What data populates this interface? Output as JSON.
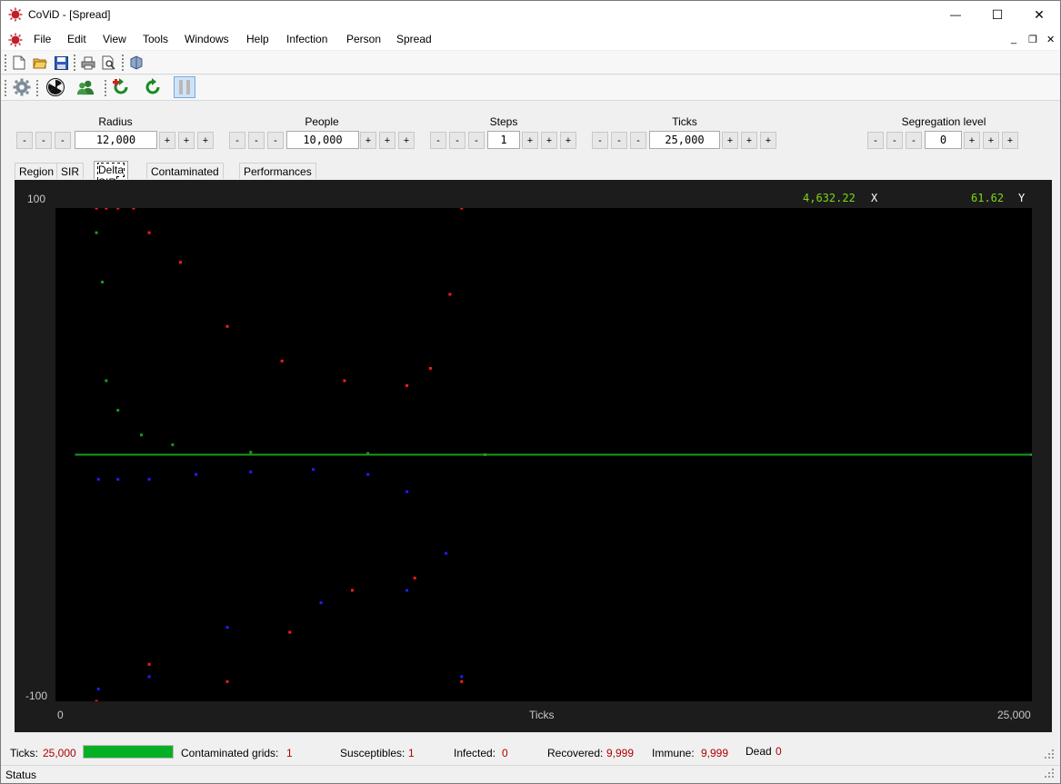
{
  "window": {
    "title": "CoViD - [Spread]"
  },
  "window_controls": {
    "minimize": "—",
    "maximize": "☐",
    "close": "✕"
  },
  "menu": {
    "items": [
      {
        "label": "File"
      },
      {
        "label": "Edit"
      },
      {
        "label": "View"
      },
      {
        "label": "Tools"
      },
      {
        "label": "Windows"
      },
      {
        "label": "Help"
      },
      {
        "label": "Infection"
      },
      {
        "label": "Person"
      },
      {
        "label": "Spread"
      }
    ],
    "mdi": {
      "minimize": "_",
      "restore": "❐",
      "close": "✕"
    }
  },
  "toolbar1": {
    "icons": [
      "new-file-icon",
      "open-folder-icon",
      "save-icon",
      "print-icon",
      "print-preview-icon",
      "help-book-icon"
    ]
  },
  "toolbar2": {
    "icons": [
      "gear-icon",
      "radiation-icon",
      "people-icon",
      "restart-icon",
      "refresh-icon",
      "pause-icon"
    ]
  },
  "controls": {
    "minus": "-",
    "plus": "+",
    "radius": {
      "label": "Radius",
      "value": "12,000"
    },
    "people": {
      "label": "People",
      "value": "10,000"
    },
    "steps": {
      "label": "Steps",
      "value": "1"
    },
    "ticks": {
      "label": "Ticks",
      "value": "25,000"
    },
    "segregation": {
      "label": "Segregation level",
      "value": "0"
    }
  },
  "tabs": [
    {
      "label": "Region",
      "active": false
    },
    {
      "label": "SIR",
      "active": false
    },
    {
      "label": "Delta SIR",
      "active": true
    },
    {
      "label": "Contaminated grids",
      "active": false
    },
    {
      "label": "Performances",
      "active": false
    }
  ],
  "plot": {
    "ymax_label": "100",
    "ymin_label": "-100",
    "xmin_label": "0",
    "xmax_label": "25,000",
    "xlabel": "Ticks",
    "cursor": {
      "x_value": "4,632.22",
      "x_label": "X",
      "y_value": "61.62",
      "y_label": "Y"
    },
    "colors": {
      "background": "#000000",
      "red": "#ff1a1a",
      "green": "#1a9a1a",
      "blue": "#1f1fff",
      "readout": "#7cd817"
    }
  },
  "chart_data": {
    "type": "scatter",
    "x": {
      "min": 0,
      "max": 25000,
      "label": "Ticks"
    },
    "y": {
      "min": -100,
      "max": 100
    },
    "baseline": 0,
    "grid": false,
    "series": [
      {
        "color": "#ff1a1a",
        "points": [
          [
            1050,
            100
          ],
          [
            1300,
            100
          ],
          [
            1600,
            100
          ],
          [
            2000,
            100
          ],
          [
            2400,
            90
          ],
          [
            3200,
            78
          ],
          [
            4400,
            52
          ],
          [
            5800,
            38
          ],
          [
            7400,
            30
          ],
          [
            9000,
            28
          ],
          [
            9600,
            35
          ],
          [
            10100,
            65
          ],
          [
            10400,
            100
          ],
          [
            1050,
            -100
          ],
          [
            2400,
            -85
          ],
          [
            4400,
            -92
          ],
          [
            6000,
            -72
          ],
          [
            7600,
            -55
          ],
          [
            9200,
            -50
          ],
          [
            10400,
            -92
          ]
        ]
      },
      {
        "color": "#1a9a1a",
        "points": [
          [
            1050,
            90
          ],
          [
            1200,
            70
          ],
          [
            1300,
            30
          ],
          [
            1600,
            18
          ],
          [
            2200,
            8
          ],
          [
            3000,
            4
          ],
          [
            5000,
            1
          ],
          [
            8000,
            0.5
          ],
          [
            11000,
            0
          ],
          [
            25000,
            0
          ]
        ]
      },
      {
        "color": "#1f1fff",
        "points": [
          [
            1100,
            -10
          ],
          [
            1600,
            -10
          ],
          [
            2400,
            -10
          ],
          [
            3600,
            -8
          ],
          [
            5000,
            -7
          ],
          [
            6600,
            -6
          ],
          [
            8000,
            -8
          ],
          [
            9000,
            -15
          ],
          [
            10000,
            -40
          ],
          [
            1100,
            -95
          ],
          [
            2400,
            -90
          ],
          [
            4400,
            -70
          ],
          [
            6800,
            -60
          ],
          [
            9000,
            -55
          ],
          [
            10400,
            -90
          ]
        ]
      }
    ]
  },
  "status": {
    "ticks_label": "Ticks:",
    "ticks_value": "25,000",
    "progress": 1.0,
    "grids_label": "Contaminated grids:",
    "grids_value": "1",
    "susceptibles_label": "Susceptibles:",
    "susceptibles_value": "1",
    "infected_label": "Infected:",
    "infected_value": "0",
    "recovered_label": "Recovered:",
    "recovered_value": "9,999",
    "immune_label": "Immune:",
    "immune_value": "9,999",
    "dead_label": "Dead",
    "dead_value": "0",
    "bottom_text": "Status"
  }
}
